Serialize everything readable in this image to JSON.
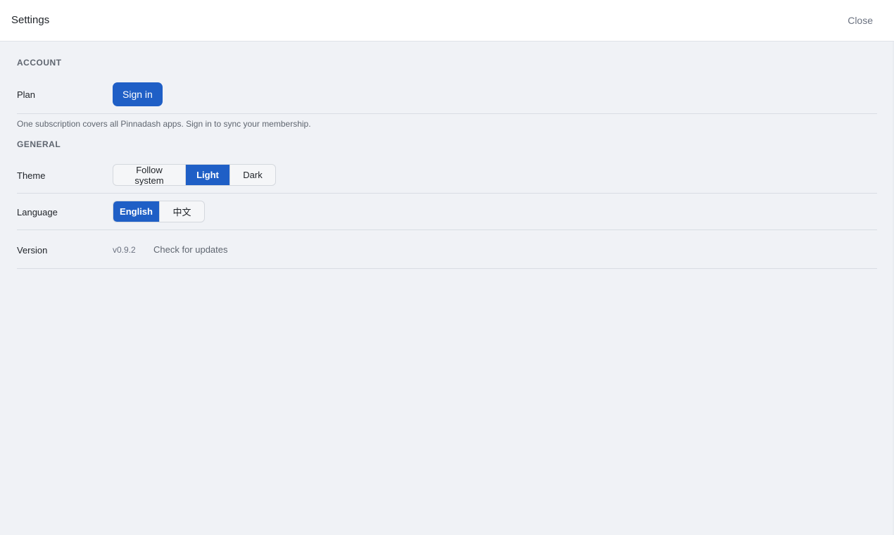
{
  "header": {
    "title": "Settings",
    "close_label": "Close"
  },
  "account": {
    "section_title": "ACCOUNT",
    "plan_label": "Plan",
    "sign_in_label": "Sign in",
    "note": "One subscription covers all Pinnadash apps. Sign in to sync your membership."
  },
  "general": {
    "section_title": "GENERAL",
    "theme": {
      "label": "Theme",
      "options": [
        "Follow system",
        "Light",
        "Dark"
      ],
      "selected": "Light"
    },
    "language": {
      "label": "Language",
      "options": [
        "English",
        "中文"
      ],
      "selected": "English"
    },
    "version": {
      "label": "Version",
      "value": "v0.9.2",
      "check_label": "Check for updates"
    }
  },
  "colors": {
    "accent": "#1f5fc6",
    "background": "#f0f2f6",
    "header_bg": "#ffffff"
  }
}
